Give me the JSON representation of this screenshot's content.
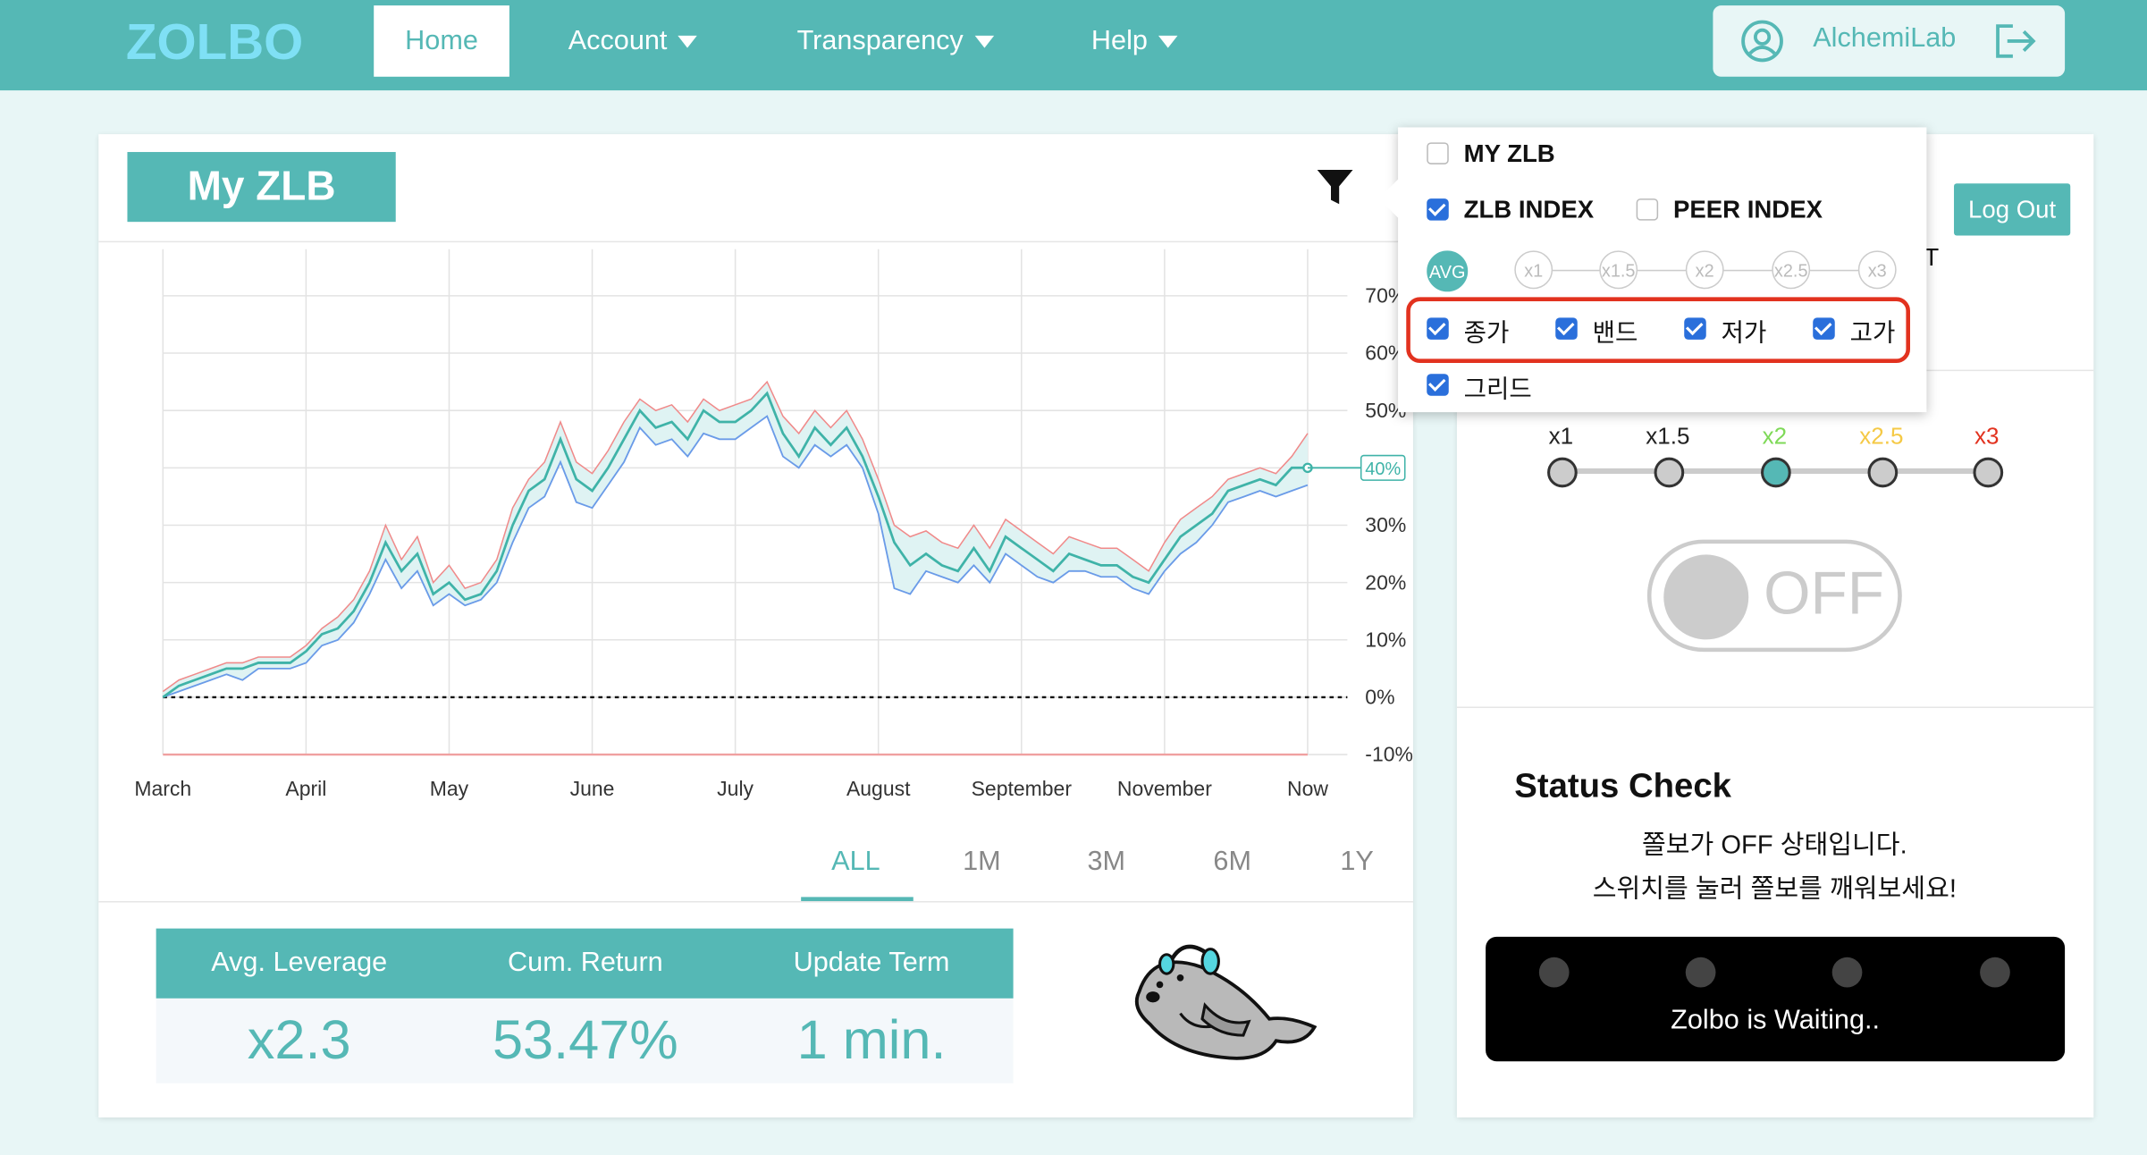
{
  "nav": {
    "logo": "ZOLBO",
    "home": "Home",
    "account": "Account",
    "transparency": "Transparency",
    "help": "Help",
    "username": "AlchemiLab"
  },
  "panel_title": "My ZLB",
  "chart_data": {
    "type": "line",
    "x_labels": [
      "March",
      "April",
      "May",
      "June",
      "July",
      "August",
      "September",
      "November",
      "Now"
    ],
    "y_ticks": [
      "70%",
      "60%",
      "50%",
      "40%",
      "30%",
      "20%",
      "10%",
      "0%",
      "-10%"
    ],
    "ylim": [
      -10,
      70
    ],
    "current_value_label": "40%",
    "series": [
      {
        "values": [
          0,
          2,
          3,
          4,
          5,
          5,
          6,
          6,
          6,
          8,
          11,
          12,
          15,
          20,
          27,
          22,
          25,
          18,
          20,
          17,
          18,
          22,
          30,
          36,
          38,
          45,
          38,
          36,
          40,
          45,
          50,
          47,
          48,
          45,
          50,
          48,
          48,
          50,
          53,
          46,
          42,
          47,
          44,
          47,
          42,
          35,
          27,
          23,
          25,
          23,
          22,
          26,
          22,
          28,
          26,
          24,
          22,
          25,
          24,
          23,
          23,
          21,
          20,
          24,
          28,
          30,
          32,
          36,
          37,
          38,
          37,
          40,
          40
        ]
      },
      {
        "values": [
          0,
          1,
          2,
          3,
          4,
          3,
          5,
          5,
          5,
          6,
          9,
          10,
          13,
          18,
          24,
          19,
          22,
          16,
          18,
          16,
          17,
          20,
          27,
          33,
          35,
          41,
          34,
          33,
          37,
          41,
          47,
          44,
          45,
          42,
          46,
          45,
          45,
          47,
          49,
          42,
          40,
          44,
          42,
          44,
          40,
          32,
          19,
          18,
          22,
          21,
          20,
          23,
          20,
          25,
          23,
          21,
          20,
          22,
          22,
          21,
          21,
          19,
          18,
          22,
          25,
          27,
          30,
          34,
          35,
          36,
          35,
          36,
          37
        ]
      },
      {
        "values": [
          1,
          3,
          4,
          5,
          6,
          6,
          7,
          7,
          7,
          9,
          12,
          14,
          17,
          22,
          30,
          24,
          28,
          20,
          23,
          19,
          20,
          24,
          33,
          38,
          41,
          48,
          41,
          39,
          43,
          48,
          52,
          50,
          51,
          48,
          52,
          50,
          51,
          52,
          55,
          49,
          46,
          50,
          47,
          50,
          45,
          38,
          30,
          28,
          29,
          27,
          26,
          30,
          26,
          31,
          29,
          27,
          25,
          28,
          27,
          26,
          26,
          24,
          22,
          27,
          31,
          33,
          35,
          38,
          39,
          40,
          39,
          42,
          46
        ]
      }
    ]
  },
  "tabs": [
    "ALL",
    "1M",
    "3M",
    "6M",
    "1Y"
  ],
  "stats": {
    "h1": "Avg. Leverage",
    "v1": "x2.3",
    "h2": "Cum. Return",
    "v2": "53.47%",
    "h3": "Update Term",
    "v3": "1 min."
  },
  "filter": {
    "my_zlb": "MY ZLB",
    "zlb_index": "ZLB INDEX",
    "peer_index": "PEER INDEX",
    "levels": [
      "AVG",
      "x1",
      "x1.5",
      "x2",
      "x2.5",
      "x3"
    ],
    "close": "종가",
    "band": "밴드",
    "low": "저가",
    "high": "고가",
    "grid": "그리드"
  },
  "right": {
    "logout": "Log Out",
    "partial_t": "T",
    "lev_labels": [
      "x1",
      "x1.5",
      "x2",
      "x2.5",
      "x3"
    ],
    "lev_colors": [
      "#222222",
      "#222222",
      "#7ed957",
      "#f5c945",
      "#e2321f"
    ],
    "toggle": "OFF",
    "status_title": "Status Check",
    "msg1": "쫄보가 OFF 상태입니다.",
    "msg2": "스위치를 눌러 쫄보를 깨워보세요!",
    "waiting": "Zolbo is Waiting.."
  }
}
